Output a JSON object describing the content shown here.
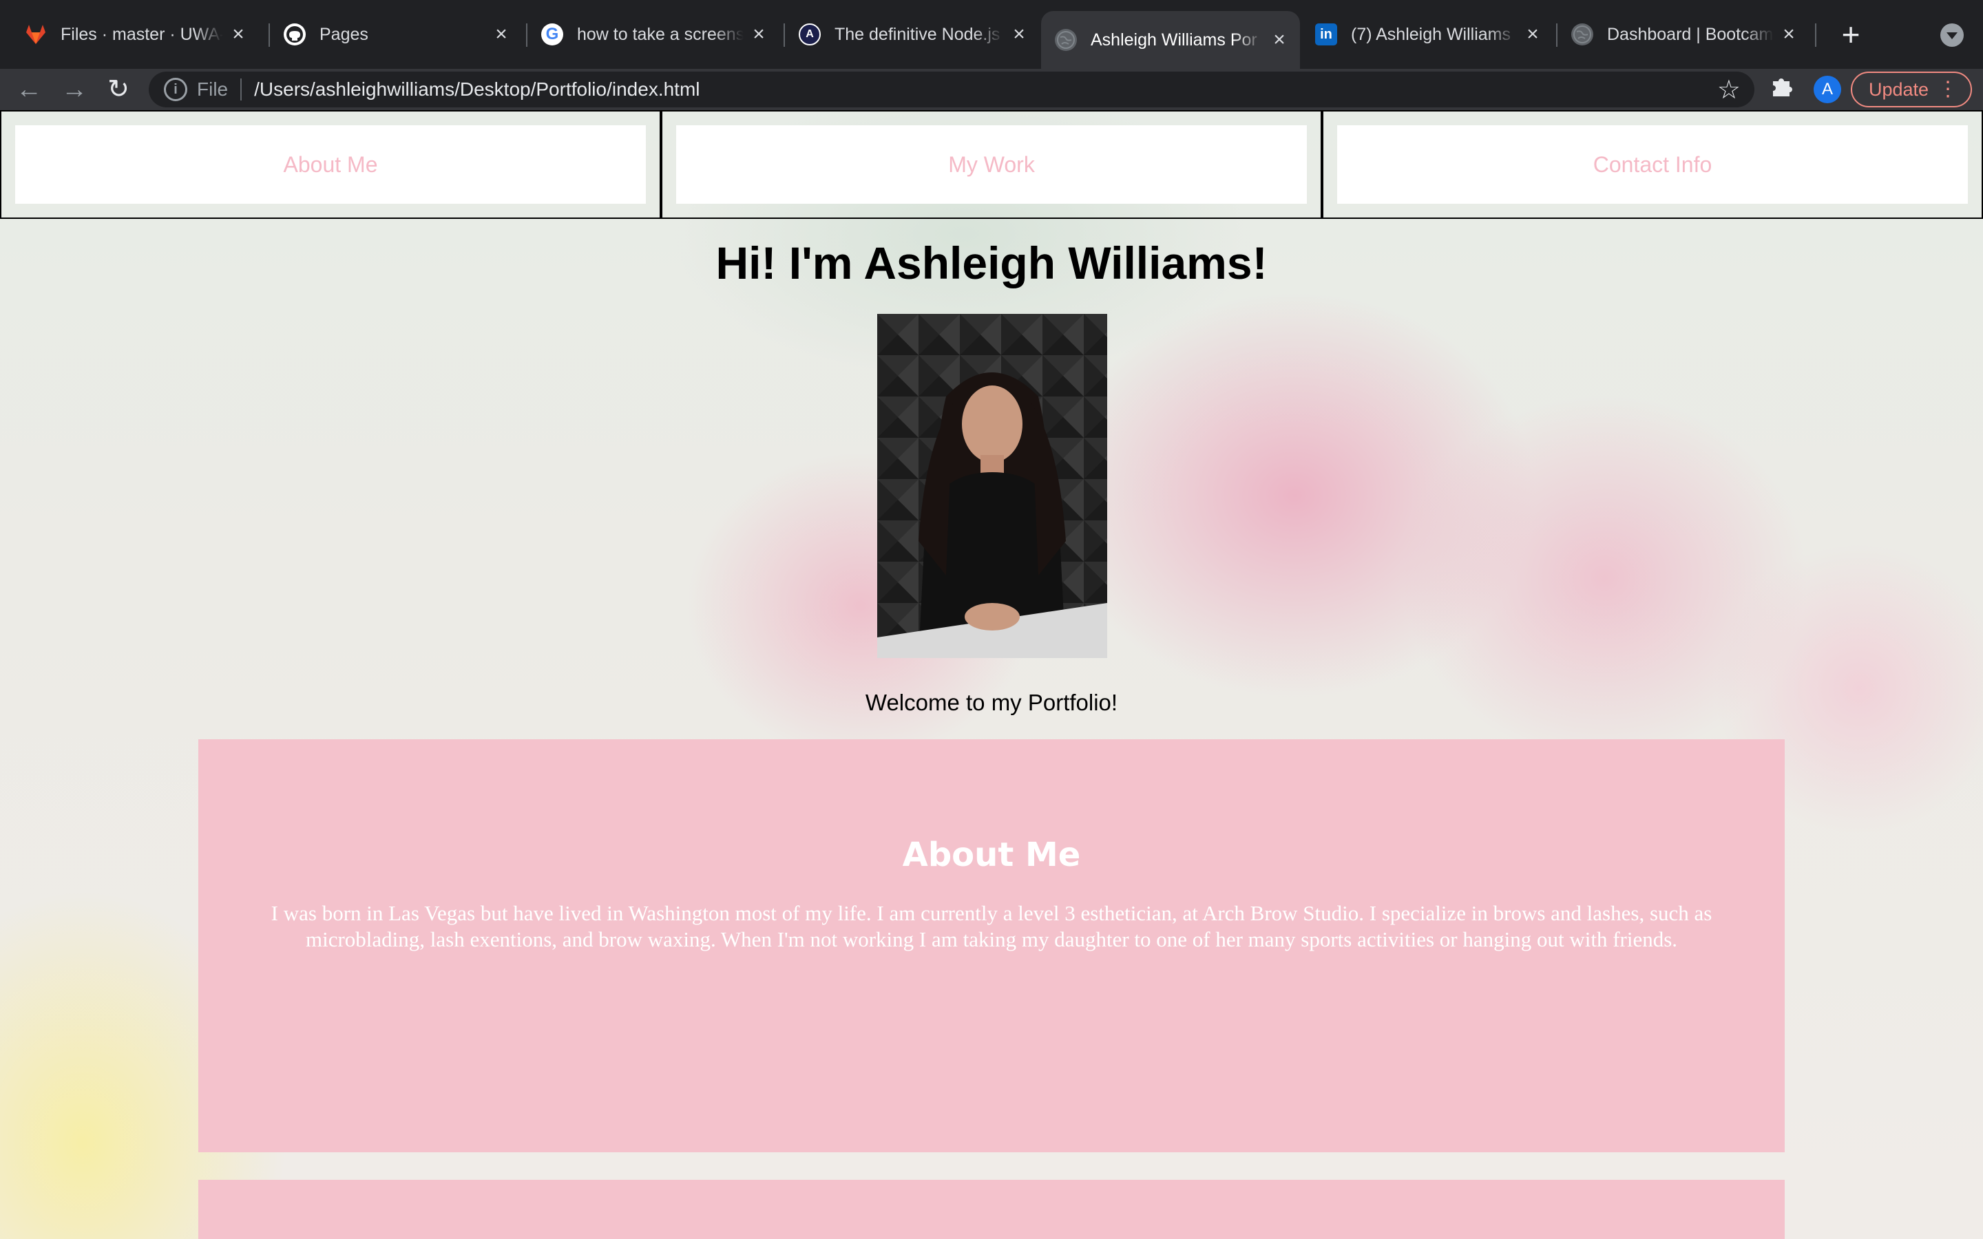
{
  "browser": {
    "tabs": [
      {
        "title": "Files · master · UWA-P",
        "icon": "gitlab-icon",
        "color": "#e24329"
      },
      {
        "title": "Pages",
        "icon": "github-icon",
        "color": "#ffffff"
      },
      {
        "title": "how to take a screens",
        "icon": "google-icon",
        "color": "#4285f4"
      },
      {
        "title": "The definitive Node.js",
        "icon": "nodejs-guide-icon",
        "color": "#1b1f4b"
      },
      {
        "title": "Ashleigh Williams Por",
        "icon": "globe-icon",
        "color": "#5f6368",
        "active": true
      },
      {
        "title": "(7) Ashleigh Williams",
        "icon": "linkedin-icon",
        "color": "#0a66c2"
      },
      {
        "title": "Dashboard | Bootcam",
        "icon": "globe-icon",
        "color": "#5f6368"
      }
    ],
    "new_tab": "+",
    "omnibox": {
      "scheme_label": "File",
      "url": "/Users/ashleighwilliams/Desktop/Portfolio/index.html"
    },
    "avatar_letter": "A",
    "update_label": "Update"
  },
  "page": {
    "nav": [
      "About Me",
      "My Work",
      "Contact Info"
    ],
    "heading": "Hi! I'm Ashleigh Williams!",
    "welcome": "Welcome to my Portfolio!",
    "about": {
      "title": "About Me",
      "text": "I was born in Las Vegas but have lived in Washington most of my life. I am currently a level 3 esthetician, at Arch Brow Studio. I specialize in brows and lashes, such as microblading, lash exentions, and brow waxing. When I'm not working I am taking my daughter to one of her many sports activities or hanging out with friends."
    },
    "colors": {
      "nav_text": "#f5b9c6",
      "section_bg": "#f4c2cc"
    }
  }
}
